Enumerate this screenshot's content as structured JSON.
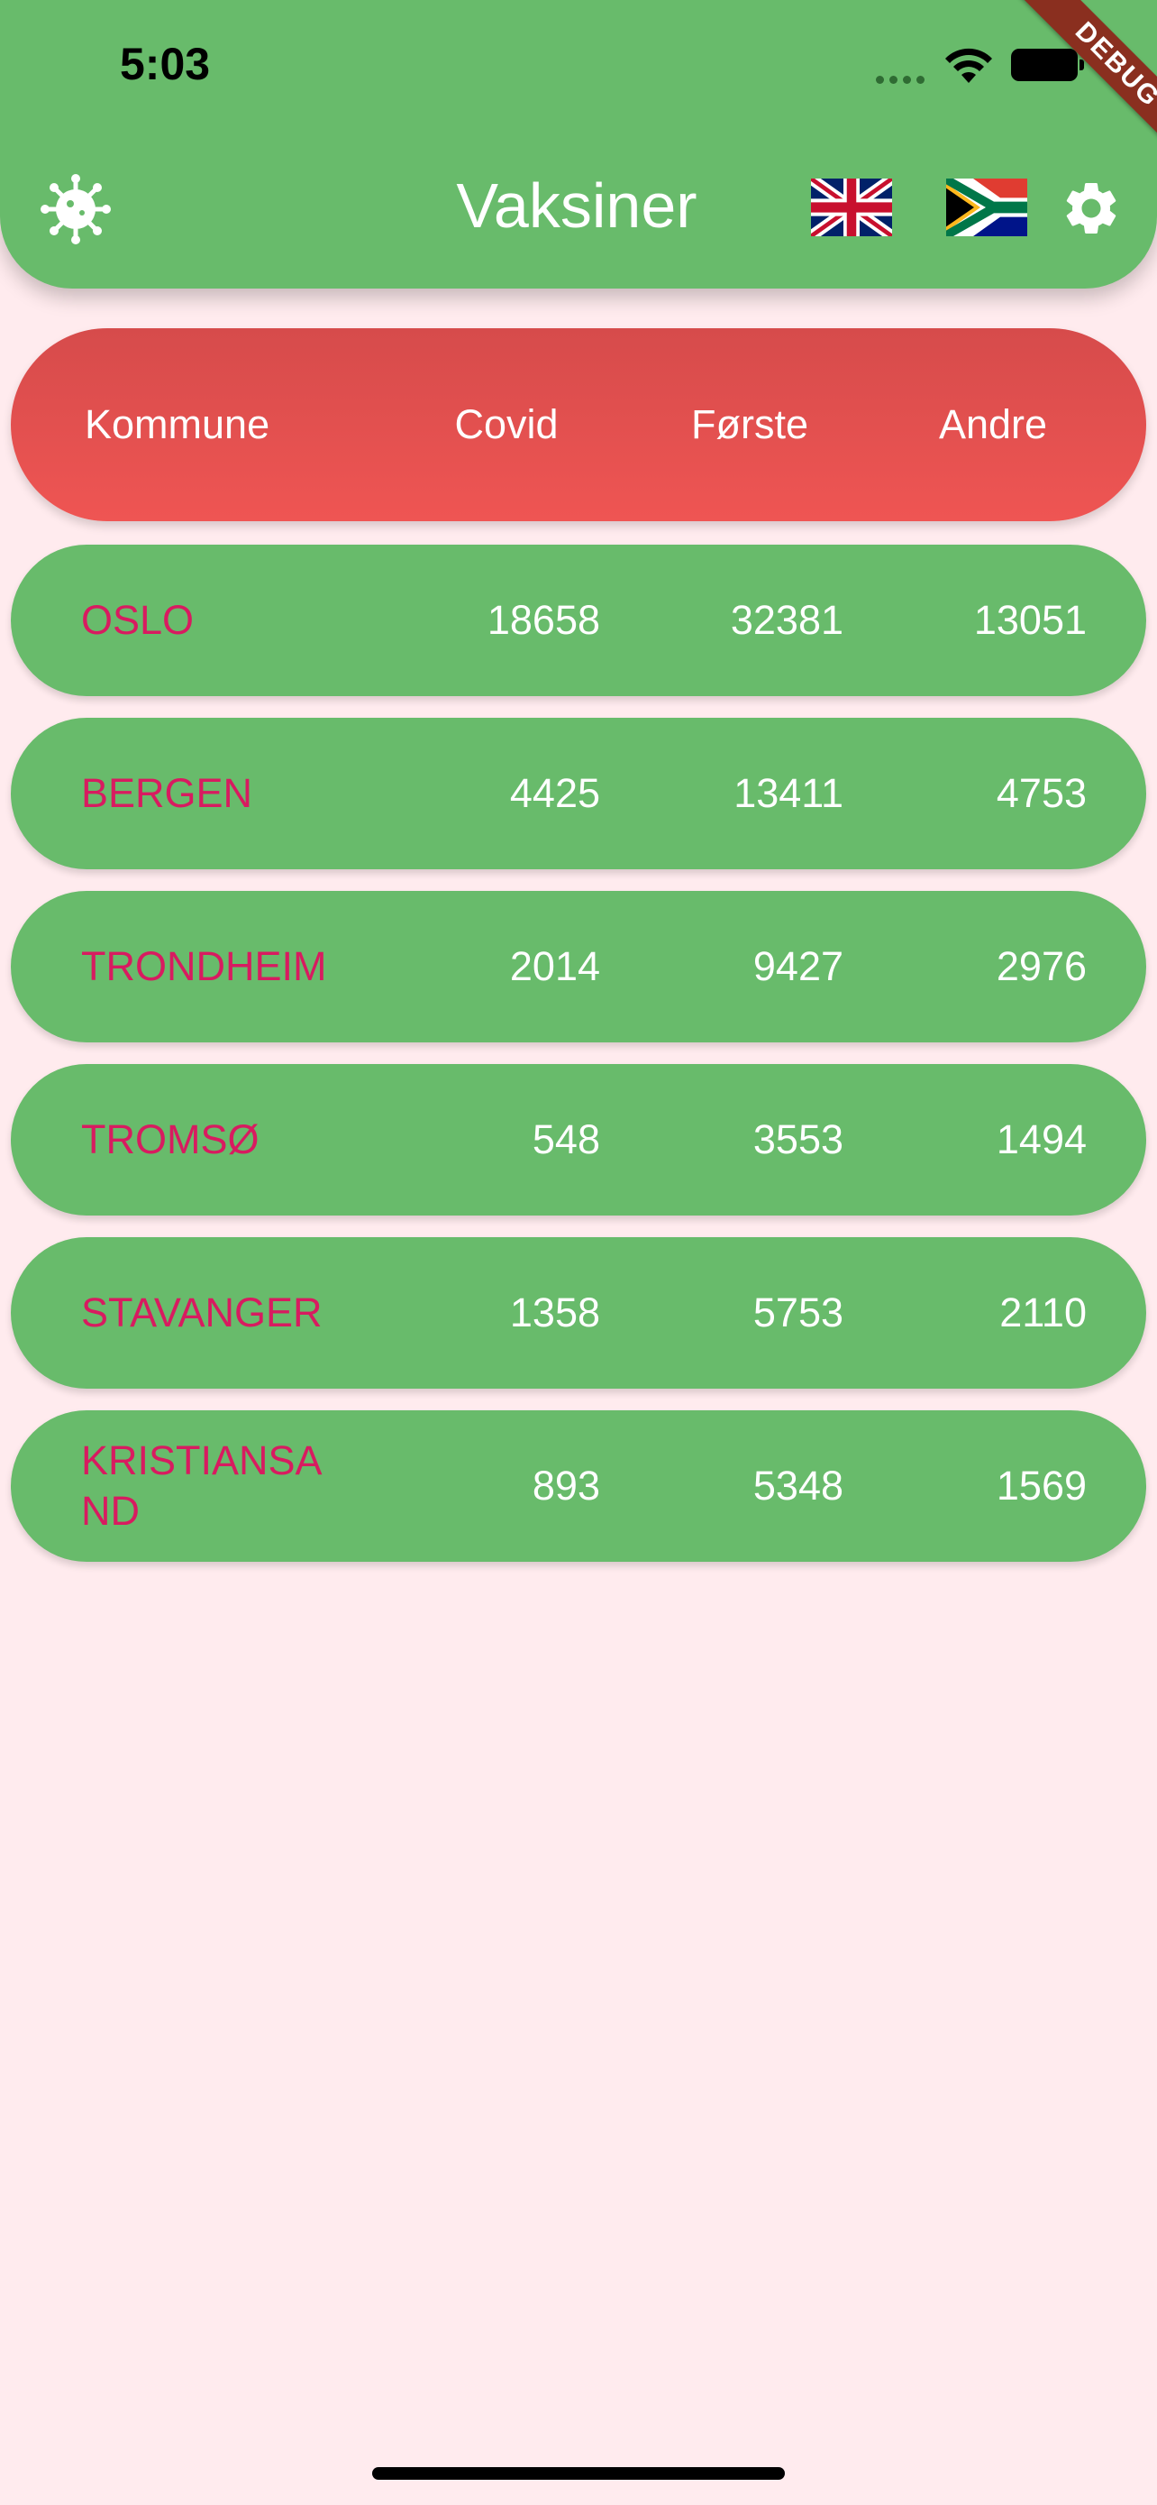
{
  "status_bar": {
    "time": "5:03"
  },
  "debug_label": "DEBUG",
  "app_bar": {
    "title": "Vaksiner",
    "left_icon": "virus-icon",
    "flags": [
      "uk-flag-icon",
      "south-africa-flag-icon"
    ],
    "settings_icon": "gear-icon"
  },
  "colors": {
    "green": "#68bb6b",
    "red": "#ef5553",
    "background": "#ffebee",
    "name_text": "#d81b60"
  },
  "table": {
    "headers": {
      "kommune": "Kommune",
      "covid": "Covid",
      "forste": "Første",
      "andre": "Andre"
    },
    "rows": [
      {
        "kommune": "OSLO",
        "covid": "18658",
        "forste": "32381",
        "andre": "13051"
      },
      {
        "kommune": "BERGEN",
        "covid": "4425",
        "forste": "13411",
        "andre": "4753"
      },
      {
        "kommune": "TRONDHEIM",
        "covid": "2014",
        "forste": "9427",
        "andre": "2976"
      },
      {
        "kommune": "TROMSØ",
        "covid": "548",
        "forste": "3553",
        "andre": "1494"
      },
      {
        "kommune": "STAVANGER",
        "covid": "1358",
        "forste": "5753",
        "andre": "2110"
      },
      {
        "kommune": "KRISTIANSAND",
        "covid": "893",
        "forste": "5348",
        "andre": "1569"
      }
    ]
  }
}
